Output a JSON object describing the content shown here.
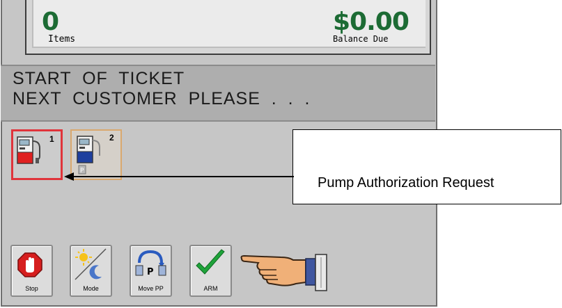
{
  "header": {
    "items_count": "0",
    "items_label": "Items",
    "balance_amount": "$0.00",
    "balance_label": "Balance Due"
  },
  "message": {
    "line1": "START  OF  TICKET",
    "line2": "NEXT  CUSTOMER  PLEASE  .  .  ."
  },
  "pumps": [
    {
      "number": "1",
      "state": "authorization-request",
      "border_color": "#e0343b"
    },
    {
      "number": "2",
      "state": "idle",
      "border_color": "#d9a86e"
    }
  ],
  "callout": {
    "text": "Pump Authorization Request"
  },
  "buttons": {
    "stop": "Stop",
    "mode": "Mode",
    "move_pp": "Move PP",
    "arm": "ARM"
  },
  "icons": {
    "stop": "stop-hand-icon",
    "mode": "sun-moon-icon",
    "move_pp": "move-prepay-icon",
    "arm": "checkmark-icon",
    "pointer": "pointing-hand-icon"
  },
  "colors": {
    "amount_green": "#1c6b34",
    "pump_alert": "#e0343b",
    "check_green": "#1fa33a"
  }
}
